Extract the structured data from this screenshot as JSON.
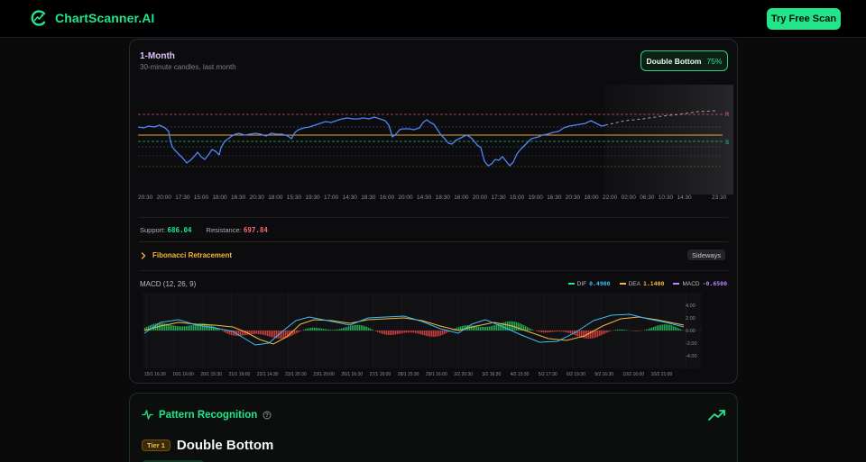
{
  "header": {
    "brand": "ChartScanner.AI",
    "cta_label": "Try Free Scan",
    "logo_icon": "chart-scanner-logo-icon",
    "accent": "#22e58a"
  },
  "chart_card": {
    "title": "1-Month",
    "subtitle": "30-minute candles, last month",
    "pattern_badge": {
      "name": "Double Bottom",
      "confidence": "75%"
    },
    "level_markers": {
      "resistance": "R",
      "support": "S"
    },
    "time_labels": [
      "20:30",
      "20:00",
      "17:30",
      "15:00",
      "18:00",
      "16:30",
      "20:30",
      "18:00",
      "15:30",
      "19:30",
      "17:00",
      "14:30",
      "18:30",
      "16:00",
      "20:00",
      "14:30",
      "18:30",
      "16:00",
      "20:00",
      "17:30",
      "15:00",
      "19:00",
      "16:30",
      "20:30",
      "18:00",
      "22:00",
      "02:00",
      "06:30",
      "10:30",
      "14:30",
      "23:30"
    ],
    "support_label": "Support:",
    "support_value": "686.04",
    "resistance_label": "Resistance:",
    "resistance_value": "697.84",
    "fib_label": "Fibonacci Retracement",
    "trend_label": "Sideways",
    "colors": {
      "price_line": "#4f86f7",
      "support": "#22e58a",
      "resistance": "#f26a6a",
      "fib": "#f5b73b"
    }
  },
  "macd": {
    "title": "MACD (12, 26, 9)",
    "legend": {
      "dif_label": "DIF",
      "dif_value": "0.4900",
      "dea_label": "DEA",
      "dea_value": "1.1400",
      "macd_label": "MACD",
      "macd_value": "-0.6500"
    },
    "y_ticks": [
      "4.00",
      "2.00",
      "0.00",
      "-2.00",
      "-4.00"
    ],
    "x_labels": [
      "15/1 16:30",
      "16/1 16:00",
      "20/1 15:30",
      "21/1 19:00",
      "22/1 14:30",
      "23/1 20:30",
      "23/1 20:00",
      "26/1 16:30",
      "27/1 16:00",
      "28/1 15:30",
      "29/1 16:00",
      "2/2 20:30",
      "3/2 16:30",
      "4/2 15:30",
      "5/2 17:30",
      "6/2 19:30",
      "9/2 16:30",
      "10/2 16:00",
      "10/2 21:00"
    ],
    "colors": {
      "dif": "#38bdf8",
      "dea": "#f5b73b",
      "macd": "#c084fc",
      "hist_pos": "#22c55e",
      "hist_neg": "#ef4444"
    }
  },
  "pattern_section": {
    "title": "Pattern Recognition",
    "tier": "Tier 1",
    "pattern_name": "Double Bottom",
    "icons": {
      "pulse": "pulse-icon",
      "help": "help-circle-icon",
      "trend": "trend-up-icon",
      "chevron": "chevron-right-icon"
    }
  }
}
